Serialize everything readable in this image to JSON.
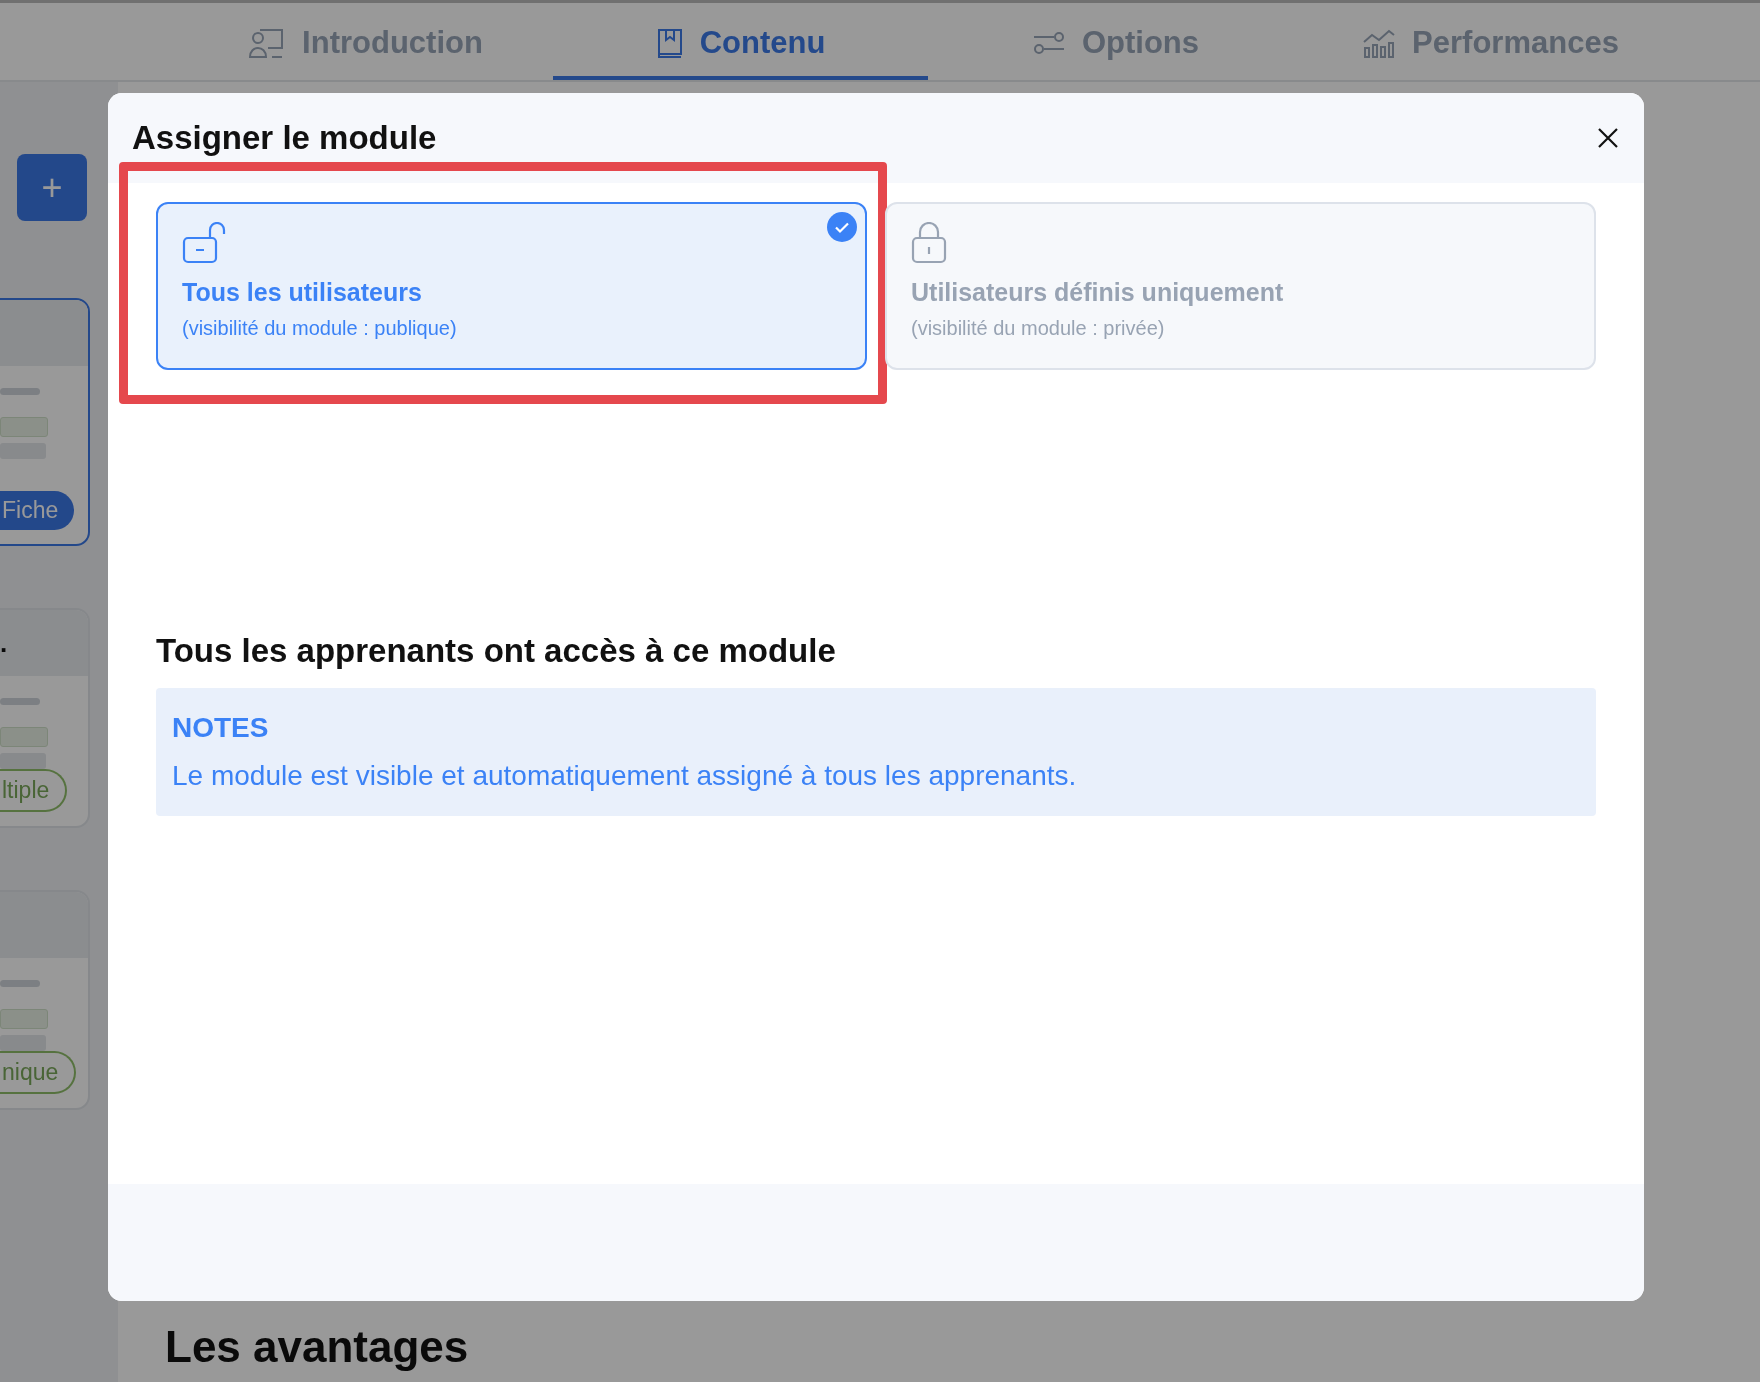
{
  "tabs": [
    {
      "label": "Introduction",
      "selected": false
    },
    {
      "label": "Contenu",
      "selected": true
    },
    {
      "label": "Options",
      "selected": false
    },
    {
      "label": "Performances",
      "selected": false
    }
  ],
  "sidebar": {
    "add_button": "+",
    "cards": [
      {
        "pill": "Fiche",
        "selected": true
      },
      {
        "title": ".",
        "pill": "ltiple",
        "selected": false
      },
      {
        "pill": "nique",
        "selected": false
      }
    ]
  },
  "page_heading": "Les avantages",
  "dialog": {
    "title": "Assigner le module",
    "options": [
      {
        "kind": "unlocked",
        "title": "Tous les utilisateurs",
        "subtitle": "(visibilité du module : publique)",
        "selected": true,
        "highlighted": true
      },
      {
        "kind": "locked",
        "title": "Utilisateurs définis uniquement",
        "subtitle": "(visibilité du module : privée)",
        "selected": false,
        "highlighted": false
      }
    ],
    "section_heading": "Tous les apprenants ont accès à ce module",
    "notes": {
      "label": "NOTES",
      "text": "Le module est visible et automatiquement assigné à tous les apprenants."
    }
  }
}
